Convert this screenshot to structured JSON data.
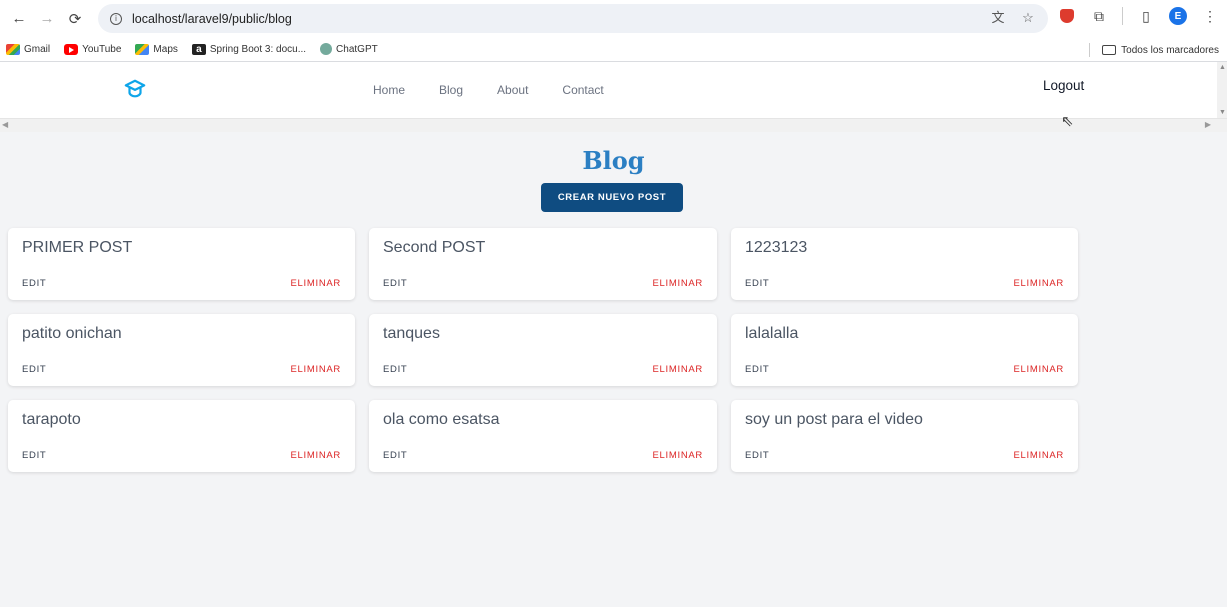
{
  "browser": {
    "url": "localhost/laravel9/public/blog",
    "bookmarks": [
      "Gmail",
      "YouTube",
      "Maps",
      "Spring Boot 3: docu...",
      "ChatGPT"
    ],
    "all_bookmarks": "Todos los marcadores",
    "profile_initial": "E"
  },
  "navbar": {
    "links": [
      "Home",
      "Blog",
      "About",
      "Contact"
    ],
    "logout": "Logout",
    "logo_color": "#0ea5e9"
  },
  "page": {
    "title": "Blog",
    "create_button": "CREAR NUEVO POST",
    "edit_label": "EDIT",
    "delete_label": "ELIMINAR",
    "posts": [
      "PRIMER POST",
      "Second POST",
      "1223123",
      "patito onichan",
      "tanques",
      "lalalalla",
      "tarapoto",
      "ola como esatsa",
      "soy un post para el video"
    ]
  },
  "colors": {
    "accent": "#2b7fc3",
    "button_bg": "#0f4c81",
    "delete": "#dc2626",
    "page_bg": "#f3f4f6"
  }
}
